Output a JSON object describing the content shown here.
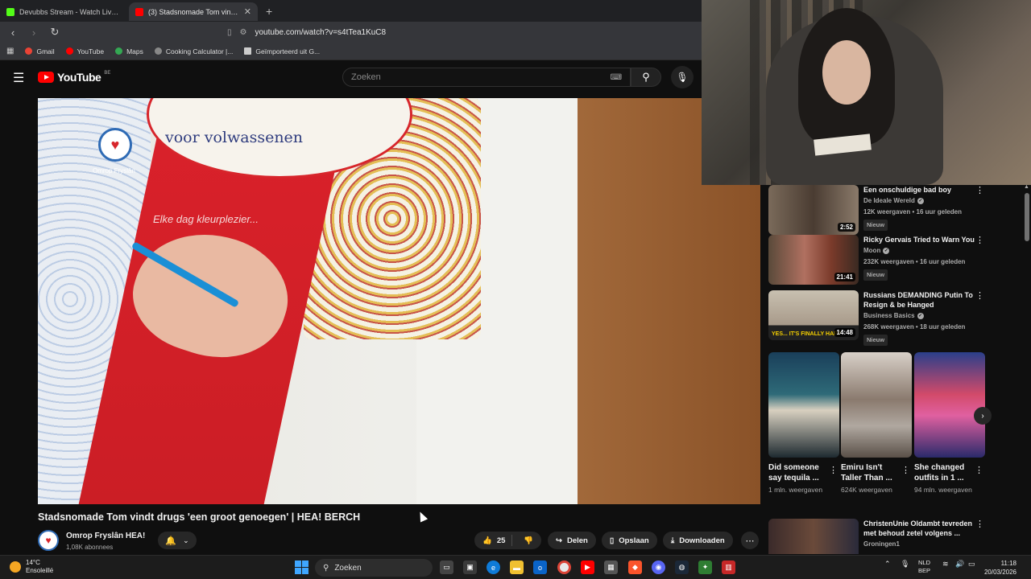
{
  "browser": {
    "tabs": [
      {
        "title": "Devubbs Stream - Watch Live on",
        "favicon_color": "#53fc18",
        "active": false
      },
      {
        "title": "(3) Stadsnomade Tom vindt d",
        "favicon_color": "#ff0000",
        "active": true
      }
    ],
    "new_tab": "+",
    "close": "✕",
    "url": "youtube.com/watch?v=s4tTea1KuC8",
    "bookmarks": [
      {
        "label": "Gmail",
        "color": "#ea4335"
      },
      {
        "label": "YouTube",
        "color": "#ff0000"
      },
      {
        "label": "Maps",
        "color": "#34a853"
      },
      {
        "label": "Cooking Calculator |...",
        "color": "#888888"
      },
      {
        "label": "Geïmporteerd uit G...",
        "color": "#cccccc"
      }
    ]
  },
  "youtube": {
    "logo_text": "YouTube",
    "country_code": "BE",
    "search_placeholder": "Zoeken"
  },
  "video": {
    "overlay_book_title": "voor volwassenen",
    "overlay_book_subtitle": "Elke dag kleurplezier...",
    "channel_bug_label": "Omrop Fryslân",
    "title": "Stadsnomade Tom vindt drugs 'een groot genoegen' | HEA! BERCH",
    "channel": "Omrop Fryslân HEA!",
    "subscribers": "1,08K abonnees",
    "likes": "25",
    "share_label": "Delen",
    "save_label": "Opslaan",
    "download_label": "Downloaden"
  },
  "sidebar": {
    "videos": [
      {
        "title": "Een onschuldige bad boy",
        "channel": "De Ideale Wereld",
        "verified": true,
        "meta": "12K weergaven • 16 uur geleden",
        "badge": "Nieuw",
        "duration": "2:52",
        "thumb_color": "#6a5a4a"
      },
      {
        "title": "Ricky Gervais Tried to Warn You",
        "channel": "Moon",
        "verified": true,
        "meta": "232K weergaven • 16 uur geleden",
        "badge": "Nieuw",
        "duration": "21:41",
        "thumb_color": "#8a3a2a"
      },
      {
        "title": "Russians DEMANDING Putin To Resign & be Hanged",
        "channel": "Business Basics",
        "verified": true,
        "meta": "268K weergaven • 18 uur geleden",
        "badge": "Nieuw",
        "duration": "14:48",
        "thumb_color": "#b8b0a0",
        "thumb_caption": "YES... IT'S FINALLY HAPP"
      },
      {
        "title": "ChristenUnie Oldambt tevreden met behoud zetel volgens ...",
        "channel": "Groningen1",
        "verified": false,
        "meta": "",
        "badge": "",
        "duration": "",
        "thumb_color": "#3a2a2a"
      }
    ],
    "shorts": [
      {
        "title": "Did someone say tequila ...",
        "views": "1 mln. weergaven",
        "thumb_color": "#1e3a4a"
      },
      {
        "title": "Emiru Isn't Taller Than ...",
        "views": "624K weergaven",
        "thumb_color": "#9c8f86"
      },
      {
        "title": "She changed outfits in 1 ...",
        "views": "94 mln. weergaven",
        "thumb_color": "#2a3f8a"
      }
    ]
  },
  "taskbar": {
    "weather_temp": "14°C",
    "weather_desc": "Ensoleillé",
    "search_label": "Zoeken",
    "lang_line1": "NLD",
    "lang_line2": "BEP",
    "time": "11:18",
    "date": "20/03/2026"
  }
}
